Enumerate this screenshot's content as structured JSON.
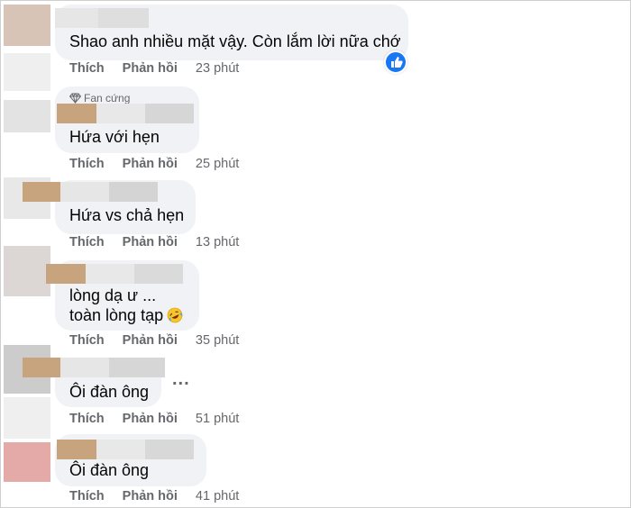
{
  "comments": [
    {
      "text_lines": [
        "Shao anh nhiều mặt vậy. Còn lắm lời nữa chớ"
      ],
      "actions": {
        "like": "Thích",
        "reply": "Phản hồi",
        "time": "23 phút"
      },
      "reaction": "like-icon"
    },
    {
      "badge": "Fan cứng",
      "text_lines": [
        "Hứa với hẹn"
      ],
      "actions": {
        "like": "Thích",
        "reply": "Phản hồi",
        "time": "25 phút"
      }
    },
    {
      "text_lines": [
        "Hứa vs chả hẹn"
      ],
      "actions": {
        "like": "Thích",
        "reply": "Phản hồi",
        "time": "13 phút"
      }
    },
    {
      "text_lines": [
        "lòng dạ ư ...",
        "toàn lòng tạp"
      ],
      "emoji": "rofl-emoji",
      "actions": {
        "like": "Thích",
        "reply": "Phản hồi",
        "time": "35 phút"
      }
    },
    {
      "text_lines": [
        "Ôi đàn ông"
      ],
      "actions": {
        "like": "Thích",
        "reply": "Phản hồi",
        "time": "51 phút"
      },
      "more": "..."
    },
    {
      "text_lines": [
        "Ôi đàn ông"
      ],
      "actions": {
        "like": "Thích",
        "reply": "Phản hồi",
        "time": "41 phút"
      }
    }
  ],
  "colors": {
    "bubble": "#f0f2f5",
    "meta_text": "#65676b",
    "like_blue": "#1877f2",
    "name_blur_brown": "#c8a47e",
    "name_blur_gray": "#d9d9d9"
  }
}
